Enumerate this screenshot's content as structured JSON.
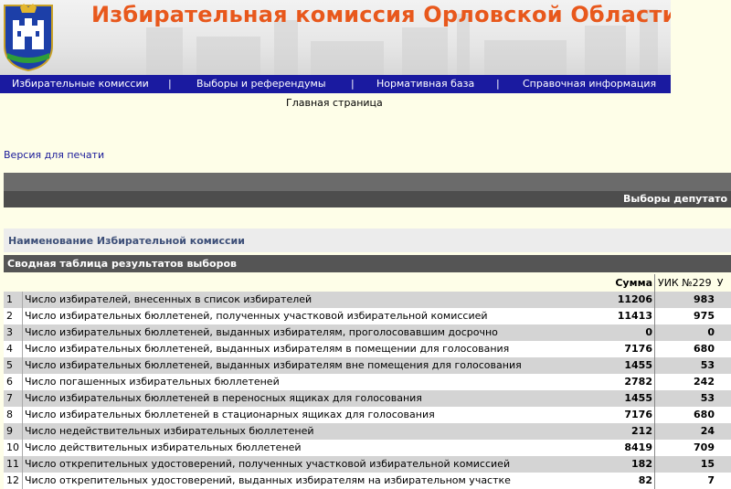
{
  "header": {
    "title": "Избирательная комиссия Орловской Области"
  },
  "nav": {
    "items": [
      "Избирательные комиссии",
      "Выборы и референдумы",
      "Нормативная база",
      "Справочная информация"
    ],
    "separator": "|"
  },
  "home_link": "Главная страница",
  "print_link": "Версия для печати",
  "elections_title": "Выборы депутато",
  "commission_label": "Наименование Избирательной комиссии",
  "summary_label": "Сводная таблица результатов выборов",
  "table": {
    "col_sum": "Сумма",
    "col_uik": "УИК №229",
    "col_uik_next": "У",
    "rows": [
      {
        "n": "1",
        "label": "Число избирателей, внесенных в список избирателей",
        "sum": "11206",
        "uik": "983"
      },
      {
        "n": "2",
        "label": "Число избирательных бюллетеней, полученных участковой избирательной комиссией",
        "sum": "11413",
        "uik": "975"
      },
      {
        "n": "3",
        "label": "Число избирательных бюллетеней, выданных избирателям, проголосовавшим досрочно",
        "sum": "0",
        "uik": "0"
      },
      {
        "n": "4",
        "label": "Число избирательных бюллетеней, выданных избирателям в помещении для голосования",
        "sum": "7176",
        "uik": "680"
      },
      {
        "n": "5",
        "label": "Число избирательных бюллетеней, выданных избирателям вне помещения для голосования",
        "sum": "1455",
        "uik": "53"
      },
      {
        "n": "6",
        "label": "Число погашенных избирательных бюллетеней",
        "sum": "2782",
        "uik": "242"
      },
      {
        "n": "7",
        "label": "Число избирательных бюллетеней в переносных ящиках для голосования",
        "sum": "1455",
        "uik": "53"
      },
      {
        "n": "8",
        "label": "Число избирательных бюллетеней в стационарных ящиках для голосования",
        "sum": "7176",
        "uik": "680"
      },
      {
        "n": "9",
        "label": "Число недействительных избирательных бюллетеней",
        "sum": "212",
        "uik": "24"
      },
      {
        "n": "10",
        "label": "Число действительных избирательных бюллетеней",
        "sum": "8419",
        "uik": "709"
      },
      {
        "n": "11",
        "label": "Число открепительных удостоверений, полученных участковой избирательной комиссией",
        "sum": "182",
        "uik": "15"
      },
      {
        "n": "12",
        "label": "Число открепительных удостоверений, выданных избирателям на избирательном участке",
        "sum": "82",
        "uik": "7"
      }
    ]
  }
}
